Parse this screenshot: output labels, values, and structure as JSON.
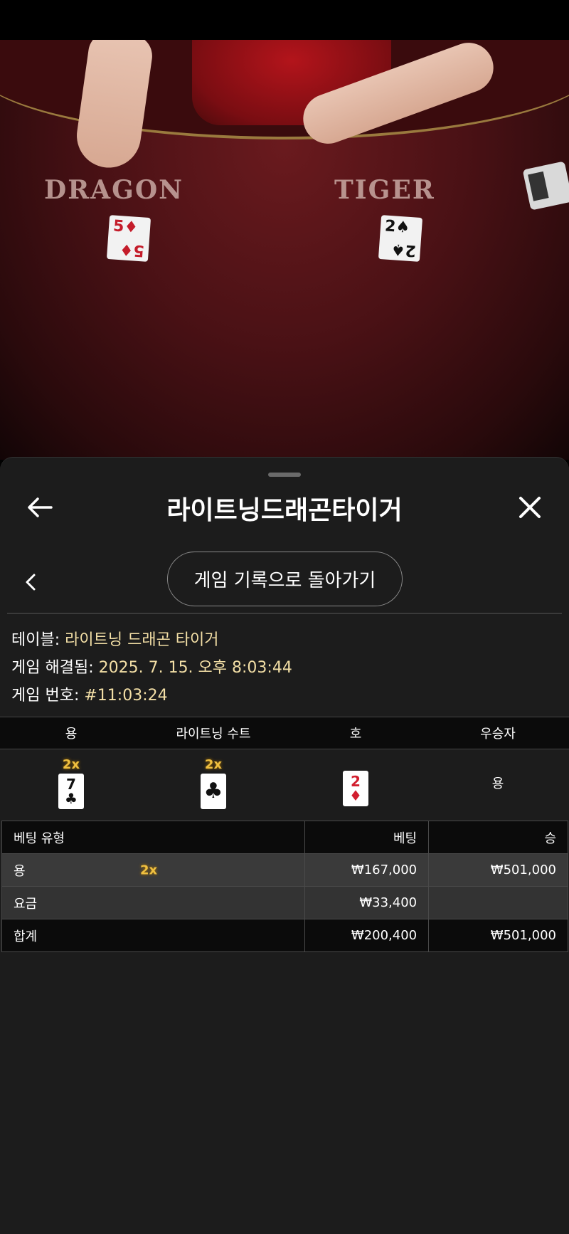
{
  "video": {
    "dragon_label": "DRAGON",
    "tiger_label": "TIGER",
    "dragon_card": {
      "rank": "5",
      "suit": "♦"
    },
    "tiger_card": {
      "rank": "2",
      "suit": "♠"
    }
  },
  "header": {
    "title": "라이트닝드래곤타이거",
    "back_icon": "arrow-left-icon",
    "close_icon": "close-icon"
  },
  "nav": {
    "prev_icon": "chevron-left-icon",
    "back_to_history": "게임 기록으로 돌아가기"
  },
  "info": {
    "table_label": "테이블: ",
    "table_value": "라이트닝 드래곤 타이거",
    "resolved_label": "게임 해결됨: ",
    "resolved_value": "2025. 7. 15. 오후 8:03:44",
    "number_label": "게임 번호: ",
    "number_value": "#11:03:24"
  },
  "round": {
    "headers": [
      "용",
      "라이트닝 수트",
      "호",
      "우승자"
    ],
    "dragon": {
      "multiplier": "2x",
      "rank": "7",
      "suit": "♣"
    },
    "lightning_suit": {
      "multiplier": "2x",
      "suit": "♣"
    },
    "tiger": {
      "rank": "2",
      "suit": "♦"
    },
    "winner": "용"
  },
  "bets": {
    "headers": {
      "type": "베팅 유형",
      "bet": "베팅",
      "win": "승"
    },
    "rows": [
      {
        "type": "용",
        "multiplier": "2x",
        "bet": "₩167,000",
        "win": "₩501,000"
      },
      {
        "type": "요금",
        "bet": "₩33,400",
        "win": ""
      },
      {
        "type": "합계",
        "bet": "₩200,400",
        "win": "₩501,000"
      }
    ]
  },
  "colors": {
    "accent_text": "#f3dfa6",
    "multiplier": "#f0c040",
    "sheet_bg": "#1c1c1c"
  }
}
